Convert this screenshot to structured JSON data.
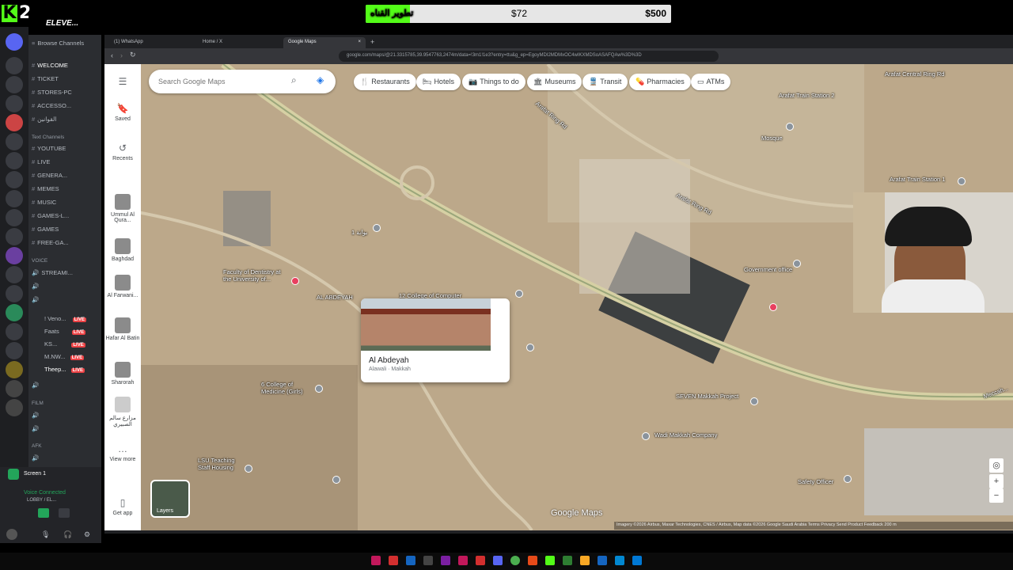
{
  "overlay": {
    "brand_number": "2",
    "donation_label": "تطوير القناه",
    "donation_current": "$72",
    "donation_goal": "$500",
    "donation_progress": 0.144,
    "accent": "#53fc18"
  },
  "discord": {
    "server_name": "ELEVE...",
    "browse_channels": "Browse Channels",
    "top_channels": [
      {
        "name": "WELCOME",
        "selected": true
      },
      {
        "name": "TICKET"
      },
      {
        "name": "STORES-PC"
      },
      {
        "name": "ACCESSO..."
      },
      {
        "name": "القوانين"
      }
    ],
    "text_category": "Text Channels",
    "text_channels": [
      "YOUTUBE",
      "LIVE",
      "GENERA...",
      "MEMES",
      "MUSIC",
      "GAMES-L...",
      "GAMES",
      "FREE-GA..."
    ],
    "voice_category": "VOICE",
    "voice_channels": [
      "STREAMI...",
      "",
      ""
    ],
    "voice_users": [
      {
        "name": "! Veno...",
        "badge": "LIVE"
      },
      {
        "name": "Faats",
        "badge": "LIVE"
      },
      {
        "name": "KS...",
        "badge": "LIVE"
      },
      {
        "name": "M.NW...",
        "badge": "LIVE"
      },
      {
        "name": "Theep...",
        "badge": "LIVE"
      }
    ],
    "film_category": "FILM",
    "afk_category": "AFK",
    "screen_share": "Screen 1",
    "voice_status": "Voice Connected",
    "voice_channel_path": "LOBBY / EL...",
    "live_color": "#ed4245"
  },
  "browser": {
    "tabs": [
      {
        "label": "(1) WhatsApp"
      },
      {
        "label": "Home / X"
      },
      {
        "label": "Google Maps",
        "active": true
      }
    ],
    "url": "google.com/maps/@21.3315785,39.9547763,2474m/data=!3m1!1e3?entry=ttu&g_ep=EgoyMDI2MDMxOC4wIKXMDSoASAFQAw%3D%3D"
  },
  "maps": {
    "search_placeholder": "Search Google Maps",
    "chips": [
      {
        "label": "Restaurants",
        "icon": "fork-knife-icon"
      },
      {
        "label": "Hotels",
        "icon": "bed-icon"
      },
      {
        "label": "Things to do",
        "icon": "camera-icon"
      },
      {
        "label": "Museums",
        "icon": "museum-icon"
      },
      {
        "label": "Transit",
        "icon": "train-icon"
      },
      {
        "label": "Pharmacies",
        "icon": "pharmacy-icon"
      },
      {
        "label": "ATMs",
        "icon": "atm-icon"
      }
    ],
    "rail": {
      "saved": "Saved",
      "recents": "Recents",
      "places": [
        "Ummul Al Qura...",
        "Baghdad",
        "Al Farwani...",
        "Hafar Al Batin",
        "Sharorah",
        "مزارع سالم الصبيري"
      ],
      "view_more": "View more",
      "get_app": "Get app"
    },
    "labels": {
      "faculty": "Faculty of Dentistry at the University of...",
      "al_abdeyah": "AL ABDEYAH",
      "college_computer": "12 College of Computer",
      "college_medicine": "6 College of Medicine (Girls)",
      "lsu_teaching": "LSU Teaching Staff Housing",
      "seven": "SEVEN Makkah Project",
      "wadi": "Wadi Makkah Company",
      "safety": "Safety Officer",
      "arafat_ring": "Arafat Ring Rd",
      "arafat_central": "Arafat Central Ring Rd",
      "arafat_station2": "Arafat Train Station 2",
      "arafat_station1": "Arafat Train Station 1",
      "government": "Government office",
      "mosque": "Mosque",
      "gate1": "بوابة 1",
      "meccah": "Meccah..."
    },
    "card": {
      "title": "Al Abdeyah",
      "subtitle": "Alawali · Makkah"
    },
    "layers": "Layers",
    "brand": "Google Maps",
    "attribution": "Imagery ©2026 Airbus, Maxar Technologies, CNES / Airbus, Map data ©2026 Google   Saudi Arabia   Terms   Privacy   Send Product Feedback   200 m"
  }
}
